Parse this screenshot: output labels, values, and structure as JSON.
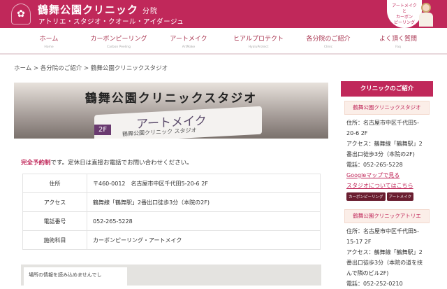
{
  "header": {
    "logo": "✿",
    "title": "鶴舞公園クリニック",
    "title_suffix": "分院",
    "subtitle": "アトリエ・スタジオ・クオール・アイダージュ",
    "bubble": [
      "アートメイク",
      "と",
      "カーボン",
      "ピーリング"
    ]
  },
  "nav": [
    {
      "ja": "ホーム",
      "en": "Home"
    },
    {
      "ja": "カーボンピーリング",
      "en": "Carbon Peeling"
    },
    {
      "ja": "アートメイク",
      "en": "ArtMake"
    },
    {
      "ja": "ヒアルプロテクト",
      "en": "HyaluProtect"
    },
    {
      "ja": "各分院のご紹介",
      "en": "Clinic"
    },
    {
      "ja": "よく頂く質問",
      "en": "Faq"
    }
  ],
  "breadcrumb": [
    "ホーム",
    "各分院のご紹介",
    "鶴舞公園クリニックスタジオ"
  ],
  "breadcrumb_sep": ">",
  "hero": {
    "title": "鶴舞公園クリニックスタジオ",
    "sign": "アートメイク",
    "sign_sub": "鶴舞公園クリニック スタジオ",
    "floor": "2F"
  },
  "note": {
    "strong": "完全予約制",
    "rest": "です。定休日は直接お電話でお問い合わせください。"
  },
  "table": [
    {
      "label": "住所",
      "value": "〒460-0012　名古屋市中区千代田5-20-6 2F"
    },
    {
      "label": "アクセス",
      "value": "鶴舞線「鶴舞駅」2番出口徒歩3分（本院の2F)"
    },
    {
      "label": "電話番号",
      "value": "052-265-5228"
    },
    {
      "label": "施術科目",
      "value": "カーボンピーリング・アートメイク"
    }
  ],
  "map": {
    "message": "場所の情報を読み込めませんでし"
  },
  "sidebar": {
    "title": "クリニックのご紹介",
    "clinics": [
      {
        "name": "鶴舞公園クリニックスタジオ",
        "address": "住所：名古屋市中区千代田5-20-6 2F",
        "access": "アクセス：鶴舞線「鶴舞駅」2番出口徒歩3分（本院の2F)",
        "tel": "電話：052-265-5228",
        "map_link": "Googleマップで見る",
        "detail_link": "スタジオについてはこちら",
        "tags": [
          "カーボンピーリング",
          "アートメイク"
        ]
      },
      {
        "name": "鶴舞公園クリニックアトリエ",
        "address": "住所：名古屋市中区千代田5-15-17 2F",
        "access": "アクセス：鶴舞線「鶴舞駅」2番出口徒歩3分（本院の道を挟んで隣のビル2F)",
        "tel": "電話：052-252-0210"
      }
    ]
  }
}
